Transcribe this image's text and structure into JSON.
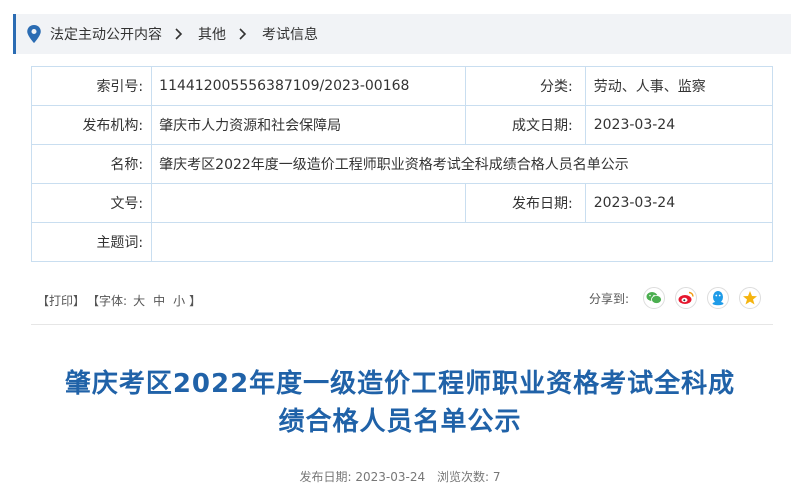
{
  "breadcrumb": {
    "items": [
      "法定主动公开内容",
      "其他",
      "考试信息"
    ]
  },
  "info": {
    "index_label": "索引号:",
    "index_value": "114412005556387109/2023-00168",
    "category_label": "分类:",
    "category_value": "劳动、人事、监察",
    "publisher_label": "发布机构:",
    "publisher_value": "肇庆市人力资源和社会保障局",
    "created_label": "成文日期:",
    "created_value": "2023-03-24",
    "name_label": "名称:",
    "name_value": "肇庆考区2022年度一级造价工程师职业资格考试全科成绩合格人员名单公示",
    "docno_label": "文号:",
    "docno_value": "",
    "pubdate_label": "发布日期:",
    "pubdate_value": "2023-03-24",
    "subject_label": "主题词:",
    "subject_value": ""
  },
  "tools": {
    "print": "【打印】",
    "font_open": "【字体:",
    "font_large": "大",
    "font_medium": "中",
    "font_small": "小",
    "font_close": "】",
    "share_label": "分享到:"
  },
  "icons": {
    "wechat": "wechat-icon",
    "weibo": "weibo-icon",
    "qq": "qq-icon",
    "qzone": "qzone-icon"
  },
  "colors": {
    "accent": "#2b6cb3",
    "title": "#2062a8",
    "wechat": "#4caf50",
    "weibo": "#e6162d",
    "qq": "#1e9be8",
    "qzone": "#f5b40f"
  },
  "article": {
    "title_line1": "肇庆考区2022年度一级造价工程师职业资格考试全科成",
    "title_line2": "绩合格人员名单公示",
    "pubdate_label": "发布日期:",
    "pubdate_value": "2023-03-24",
    "views_label": "浏览次数:",
    "views_value": "7"
  }
}
